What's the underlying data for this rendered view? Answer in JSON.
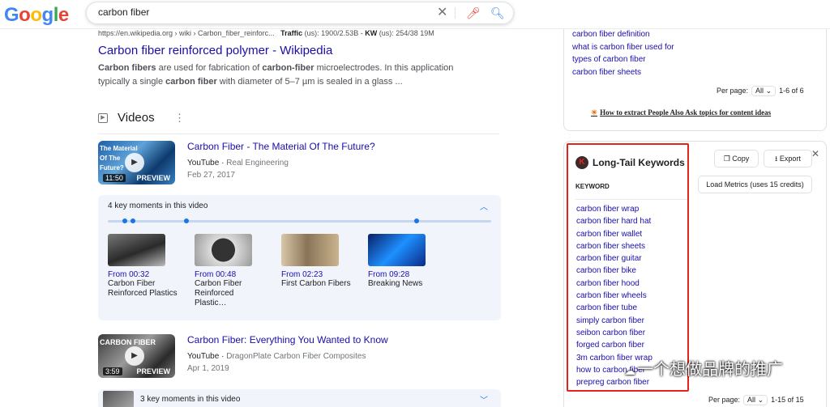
{
  "header": {
    "logo": [
      "G",
      "o",
      "o",
      "g",
      "l",
      "e"
    ],
    "search_value": "carbon fiber",
    "icons": {
      "clear": "close-icon",
      "mic": "mic-icon",
      "search": "search-icon"
    }
  },
  "result": {
    "breadcrumb": "https://en.wikipedia.org › wiki › Carbon_fiber_reinforc...",
    "traffic_label": "Traffic",
    "traffic_value": "(us): 1900/2.53B",
    "kw_label": "KW",
    "kw_value": "(us): 254/38 19M",
    "title": "Carbon fiber reinforced polymer - Wikipedia",
    "snippet_b1": "Carbon fibers",
    "snippet_t1": " are used for fabrication of ",
    "snippet_b2": "carbon-fiber",
    "snippet_t2": " microelectrodes. In this application typically a single ",
    "snippet_b3": "carbon fiber",
    "snippet_t3": " with diameter of 5–7 µm is sealed in a glass ..."
  },
  "videos": {
    "heading": "Videos",
    "items": [
      {
        "title": "Carbon Fiber - The Material Of The Future?",
        "source": "YouTube",
        "channel": "Real Engineering",
        "date": "Feb 27, 2017",
        "thumb_text": "The Material Of The Future?",
        "duration": "11:50",
        "preview": "PREVIEW"
      },
      {
        "title": "Carbon Fiber: Everything You Wanted to Know",
        "source": "YouTube",
        "channel": "DragonPlate Carbon Fiber Composites",
        "date": "Apr 1, 2019",
        "thumb_text": "CARBON FIBER",
        "duration": "3:59",
        "preview": "PREVIEW"
      }
    ],
    "moments": {
      "heading": "4 key moments in this video",
      "items": [
        {
          "from": "From 00:32",
          "label": "Carbon Fiber Reinforced Plastics"
        },
        {
          "from": "From 00:48",
          "label": "Carbon Fiber Reinforced Plastic…"
        },
        {
          "from": "From 02:23",
          "label": "First Carbon Fibers"
        },
        {
          "from": "From 09:28",
          "label": "Breaking News"
        }
      ]
    },
    "moments2_heading": "3 key moments in this video"
  },
  "right_top": {
    "links": [
      "carbon fiber definition",
      "what is carbon fiber used for",
      "types of carbon fiber",
      "carbon fiber sheets"
    ],
    "per_page_label": "Per page:",
    "per_page_value": "All",
    "range": "1-6 of 6",
    "howto": "How to extract People Also Ask topics for content ideas"
  },
  "longtail": {
    "logo_letter": "K",
    "title": "Long-Tail Keywords",
    "copy_label": "Copy",
    "export_label": "Export",
    "load_metrics_label": "Load Metrics (uses 15 credits)",
    "keyword_header": "KEYWORD",
    "keywords": [
      "carbon fiber wrap",
      "carbon fiber hard hat",
      "carbon fiber wallet",
      "carbon fiber sheets",
      "carbon fiber guitar",
      "carbon fiber bike",
      "carbon fiber hood",
      "carbon fiber wheels",
      "carbon fiber tube",
      "simply carbon fiber",
      "seibon carbon fiber",
      "forged carbon fiber",
      "3m carbon fiber wrap",
      "how to carbon fiber",
      "prepreg carbon fiber"
    ],
    "per_page_label": "Per page:",
    "per_page_value": "All",
    "range": "1-15 of 15"
  },
  "watermark": "一个想做品牌的推广",
  "colors": {
    "link": "#1a0dab",
    "highlight_box": "#e1251b",
    "accent": "#1a73e8"
  }
}
